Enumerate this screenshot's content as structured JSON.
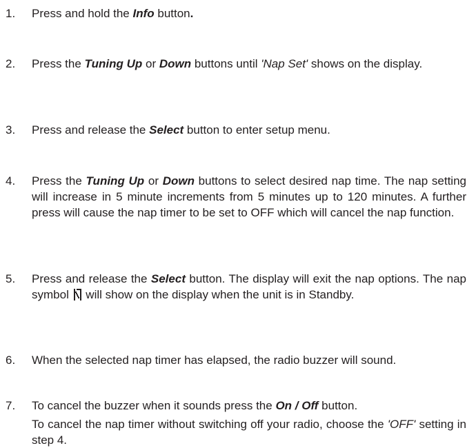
{
  "steps": [
    {
      "num": "1.",
      "p1": "Press and hold the ",
      "b1": "Info",
      "p2": " button",
      "b2": "."
    },
    {
      "num": "2.",
      "p1": "Press the ",
      "b1": "Tuning Up",
      "p2": " or ",
      "b2": "Down",
      "p3": " buttons until ",
      "q1": "'Nap Set'",
      "p4": " shows on the display."
    },
    {
      "num": "3.",
      "p1": "Press and release the ",
      "b1": "Select",
      "p2": " button to enter setup menu."
    },
    {
      "num": "4.",
      "p1": "Press the ",
      "b1": "Tuning Up",
      "p2": " or ",
      "b2": "Down",
      "p3": " buttons to select desired nap time. The nap setting will increase in 5 minute increments from 5 minutes up to 120 minutes. A further press will cause the nap timer to be set to OFF which will cancel the nap function."
    },
    {
      "num": "5.",
      "p1": "Press and release the ",
      "b1": "Select",
      "p2": " button. The display will exit the nap options. The nap symbol ",
      "p3": " will show on the display when the unit is in Standby."
    },
    {
      "num": "6.",
      "p1": "When the selected nap timer has elapsed, the radio buzzer will sound."
    },
    {
      "num": "7.",
      "p1": "To cancel the buzzer when it sounds press the ",
      "b1": "On / Off",
      "p2": " button."
    }
  ],
  "note": {
    "p1": "To cancel the nap timer without switching off your radio, choose the ",
    "q1": "'OFF'",
    "p2": " setting in step 4."
  },
  "icons": {
    "nap_symbol": "nap-timer-icon"
  }
}
